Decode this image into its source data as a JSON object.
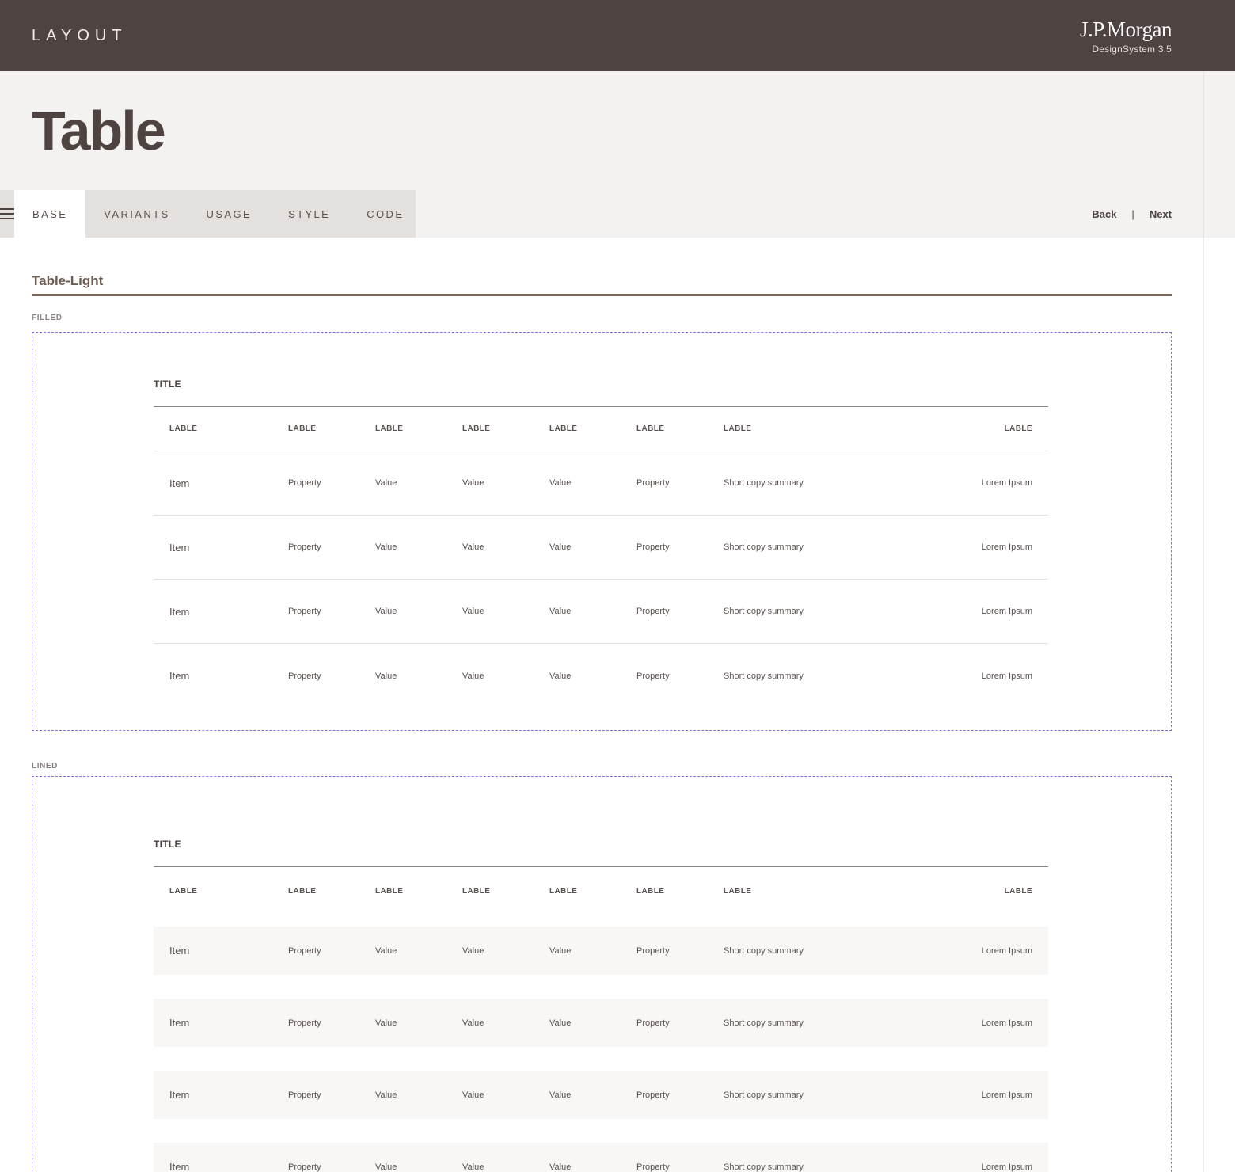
{
  "header": {
    "section": "LAYOUT",
    "brand": "J.P.Morgan",
    "brand_sub": "DesignSystem  3.5"
  },
  "page": {
    "title": "Table"
  },
  "tabs": [
    "BASE",
    "VARIANTS",
    "USAGE",
    "STYLE",
    "CODE"
  ],
  "active_tab": "BASE",
  "pager": {
    "back": "Back",
    "separator": "|",
    "next": "Next"
  },
  "section": {
    "title": "Table-Light"
  },
  "variants": [
    {
      "label": "FILLED",
      "table": {
        "title": "TITLE",
        "columns": [
          "LABLE",
          "LABLE",
          "LABLE",
          "LABLE",
          "LABLE",
          "LABLE",
          "LABLE",
          "LABLE"
        ],
        "rows": [
          [
            "Item",
            "Property",
            "Value",
            "Value",
            "Value",
            "Property",
            "Short copy summary",
            "Lorem Ipsum"
          ],
          [
            "Item",
            "Property",
            "Value",
            "Value",
            "Value",
            "Property",
            "Short copy summary",
            "Lorem Ipsum"
          ],
          [
            "Item",
            "Property",
            "Value",
            "Value",
            "Value",
            "Property",
            "Short copy summary",
            "Lorem Ipsum"
          ],
          [
            "Item",
            "Property",
            "Value",
            "Value",
            "Value",
            "Property",
            "Short copy summary",
            "Lorem Ipsum"
          ]
        ]
      }
    },
    {
      "label": "LINED",
      "table": {
        "title": "TITLE",
        "columns": [
          "LABLE",
          "LABLE",
          "LABLE",
          "LABLE",
          "LABLE",
          "LABLE",
          "LABLE",
          "LABLE"
        ],
        "rows": [
          [
            "Item",
            "Property",
            "Value",
            "Value",
            "Value",
            "Property",
            "Short copy summary",
            "Lorem Ipsum"
          ],
          [
            "Item",
            "Property",
            "Value",
            "Value",
            "Value",
            "Property",
            "Short copy summary",
            "Lorem Ipsum"
          ],
          [
            "Item",
            "Property",
            "Value",
            "Value",
            "Value",
            "Property",
            "Short copy summary",
            "Lorem Ipsum"
          ],
          [
            "Item",
            "Property",
            "Value",
            "Value",
            "Value",
            "Property",
            "Short copy summary",
            "Lorem Ipsum"
          ]
        ]
      }
    }
  ],
  "colors": {
    "topbar": "#4e4341",
    "hero_bg": "#f3f2f0",
    "accent_rule": "#7a6658",
    "frame_dash": "#8b74e0"
  }
}
